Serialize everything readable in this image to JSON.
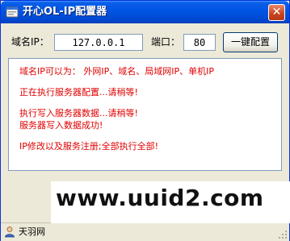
{
  "window": {
    "title": "开心OL-IP配置器",
    "close_glyph": "✕"
  },
  "form": {
    "domain_label": "域名IP：",
    "domain_value": "127.0.0.1",
    "port_label": "端口：",
    "port_value": "80",
    "config_button": "一键配置"
  },
  "log": {
    "lines": [
      "域名IP可以为： 外网IP、域名、局域网IP、单机IP",
      "正在执行服务器配置...请稍等!",
      "执行写入服务器数据...请稍等!",
      "服务器写入数据成功!",
      "IP修改以及服务注册;全部执行全部!"
    ],
    "text_color": "#e00000"
  },
  "watermark": {
    "text": "www.uuid2.com"
  },
  "statusbar": {
    "text": "天羽网",
    "icon": "author-icon"
  },
  "colors": {
    "titlebar": "#0054e3",
    "window_bg": "#ece9d8",
    "close_button": "#c7421e"
  }
}
